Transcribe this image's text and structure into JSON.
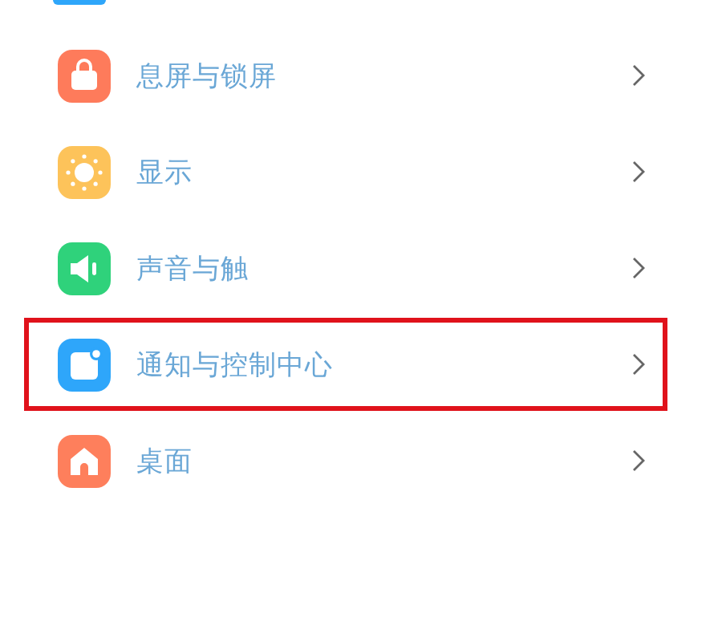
{
  "items": [
    {
      "kind": "lock",
      "label": "息屏与锁屏",
      "color": "#fe7b5b",
      "highlighted": false
    },
    {
      "kind": "sun",
      "label": "显示",
      "color": "#fdc35a",
      "highlighted": false
    },
    {
      "kind": "speaker",
      "label": "声音与触",
      "color": "#2fd27b",
      "highlighted": false
    },
    {
      "kind": "notification",
      "label": "通知与控制中心",
      "color": "#2ea6fa",
      "highlighted": true
    },
    {
      "kind": "home",
      "label": "桌面",
      "color": "#fe7f5c",
      "highlighted": false
    }
  ]
}
